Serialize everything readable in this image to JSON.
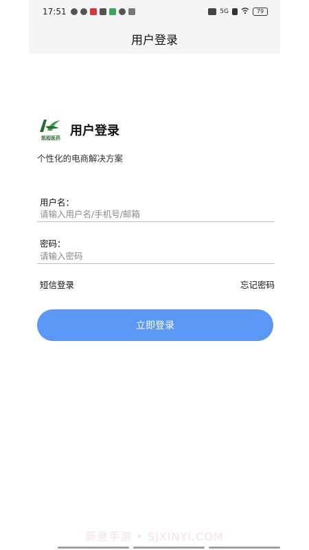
{
  "status_bar": {
    "time": "17:51",
    "network": "5G",
    "battery": "79"
  },
  "nav": {
    "title": "用户登录"
  },
  "brand": {
    "logo_text": "凯程医药",
    "title": "用户登录",
    "slogan": "个性化的电商解决方案"
  },
  "form": {
    "username_label": "用户名：",
    "username_placeholder": "请输入用户名/手机号/邮箱",
    "username_value": "",
    "password_label": "密码：",
    "password_placeholder": "请输入密码",
    "password_value": ""
  },
  "links": {
    "sms_login": "短信登录",
    "forgot_password": "忘记密码"
  },
  "login_button": "立即登录",
  "watermark": "新意手游 • SJXINYI.COM",
  "colors": {
    "primary_button": "#5b97f5",
    "logo_green": "#2e8b3a",
    "nav_bg": "#f5f5f5"
  }
}
